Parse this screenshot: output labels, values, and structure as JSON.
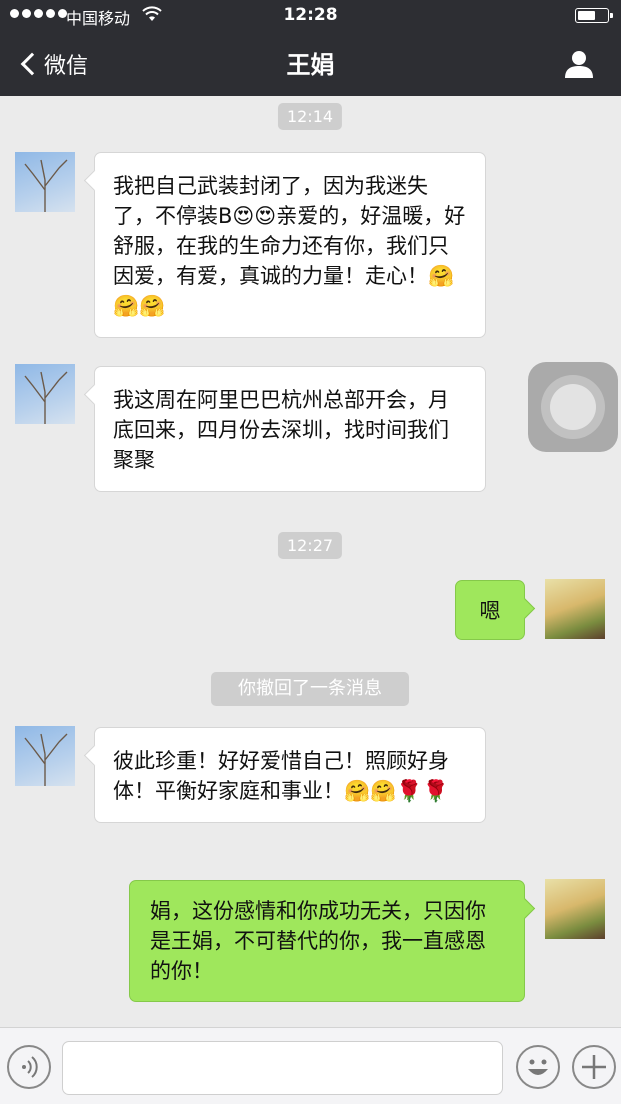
{
  "status_bar": {
    "carrier": "中国移动",
    "time": "12:28"
  },
  "nav": {
    "back_label": "微信",
    "title": "王娟"
  },
  "messages": {
    "time1": "12:14",
    "m1": "我把自己武装封闭了，因为我迷失了，不停装B😍😍亲爱的，好温暖，好舒服，在我的生命力还有你，我们只因爱，有爱，真诚的力量！走心！🤗🤗🤗",
    "m2": "我这周在阿里巴巴杭州总部开会，月底回来，四月份去深圳，找时间我们聚聚",
    "time2": "12:27",
    "m3": "嗯",
    "recall": "你撤回了一条消息",
    "m4": "彼此珍重！好好爱惜自己！照顾好身体！平衡好家庭和事业！🤗🤗🌹🌹",
    "m5": "娟，这份感情和你成功无关，只因你是王娟，不可替代的你，我一直感恩的你！"
  },
  "input": {
    "value": ""
  },
  "colors": {
    "nav_bg": "#2d2e33",
    "chat_bg": "#ebebeb",
    "sent_bubble": "#9fe75c",
    "received_bubble": "#ffffff"
  },
  "icons": {
    "back": "chevron-left-icon",
    "profile": "person-icon",
    "voice": "voice-icon",
    "emoji": "emoji-icon",
    "plus": "plus-icon"
  }
}
